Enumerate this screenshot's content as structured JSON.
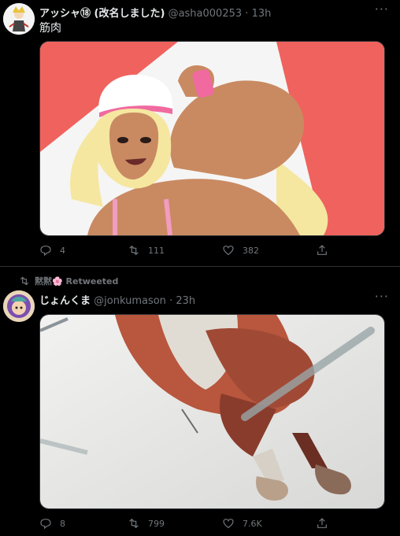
{
  "tweet1": {
    "author_name": "アッシャ⑱ (改名しました)",
    "handle": "@asha000253",
    "separator": "·",
    "time": "13h",
    "text": "筋肉",
    "more": "···",
    "actions": {
      "replies": "4",
      "retweets": "111",
      "likes": "382"
    }
  },
  "tweet2": {
    "retweeted_by": "黙黙🌸 Retweeted",
    "author_name": "じょんくま",
    "handle": "@jonkumason",
    "separator": "·",
    "time": "23h",
    "more": "···",
    "actions": {
      "replies": "8",
      "retweets": "799",
      "likes": "7.6K"
    }
  },
  "colors": {
    "background": "#000000",
    "muted": "#71767b",
    "accent_red": "#f0625d",
    "divider": "#2f3336"
  },
  "icons": [
    "reply-icon",
    "retweet-icon",
    "like-icon",
    "share-icon",
    "more-icon"
  ]
}
